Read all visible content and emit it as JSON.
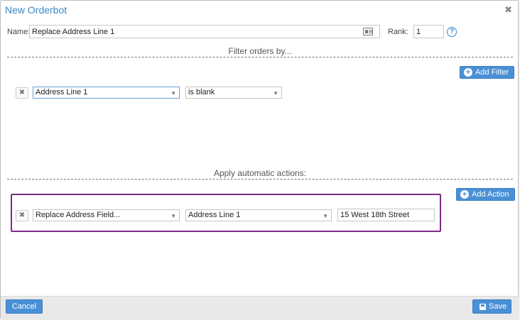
{
  "modal": {
    "title": "New Orderbot",
    "close_glyph": "✖"
  },
  "form": {
    "name_label": "Name:",
    "name_value": "Replace Address Line 1",
    "rank_label": "Rank:",
    "rank_value": "1",
    "help_glyph": "?"
  },
  "filters": {
    "section_title": "Filter orders by...",
    "add_button_label": "Add Filter",
    "rows": [
      {
        "remove_glyph": "✖",
        "field": "Address Line 1",
        "condition": "is blank"
      }
    ]
  },
  "actions": {
    "section_title": "Apply automatic actions:",
    "add_button_label": "Add Action",
    "rows": [
      {
        "remove_glyph": "✖",
        "action": "Replace Address Field...",
        "target_field": "Address Line 1",
        "value": "15 West 18th Street"
      }
    ]
  },
  "footer": {
    "cancel_label": "Cancel",
    "save_label": "Save"
  },
  "icons": {
    "plus": "+",
    "caret": "▼"
  },
  "colors": {
    "accent": "#4a90d6",
    "title": "#3a87c8",
    "highlight": "#7b2c86"
  }
}
